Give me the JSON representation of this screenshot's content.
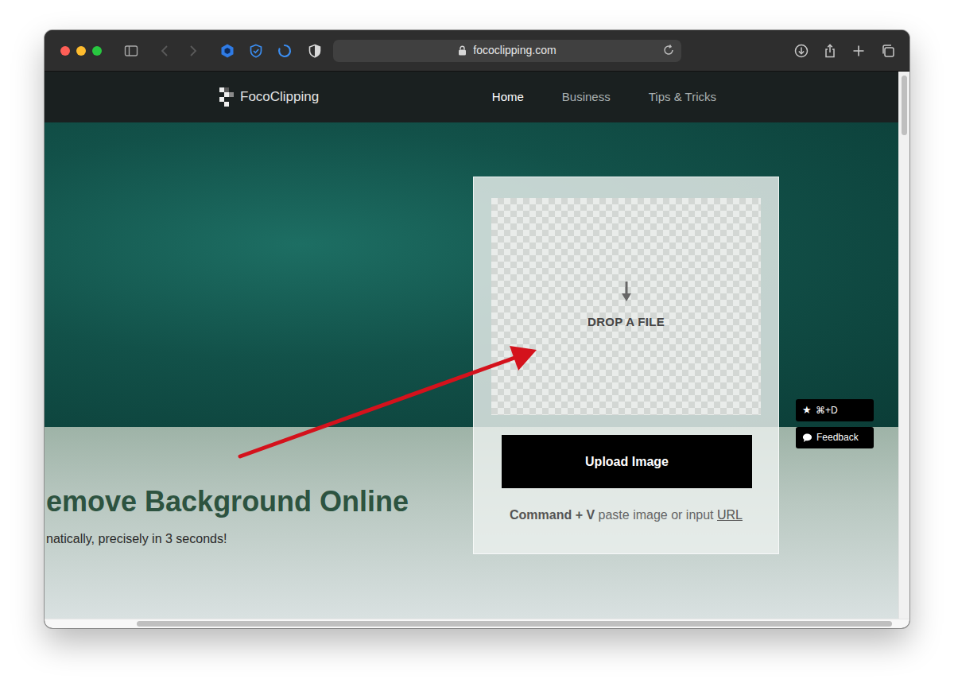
{
  "window": {
    "controls": [
      {
        "color": "#ff5f57"
      },
      {
        "color": "#febc2e"
      },
      {
        "color": "#28c840"
      }
    ],
    "back_disabled": true,
    "forward_disabled": true
  },
  "browser": {
    "url": "fococlipping.com"
  },
  "site": {
    "logo": "FocoClipping",
    "nav": [
      {
        "label": "Home",
        "selected": true
      },
      {
        "label": "Business",
        "selected": false
      },
      {
        "label": "Tips & Tricks",
        "selected": false
      }
    ]
  },
  "hero": {
    "heading": "emove Background Online",
    "subheading": "natically, precisely in 3 seconds!"
  },
  "upload": {
    "drop_label": "DROP A FILE",
    "button": "Upload Image",
    "hint": {
      "keys": "Command + V",
      "text": "paste image or input",
      "link": "URL"
    }
  },
  "floating": [
    {
      "kind": "shortcut",
      "icon": "★",
      "label": "⌘+D"
    },
    {
      "kind": "feedback",
      "label": "Feedback"
    }
  ],
  "scrollbars": {
    "vertical": {
      "level": 0.11
    },
    "horizontal": {
      "level": 0.885
    }
  }
}
